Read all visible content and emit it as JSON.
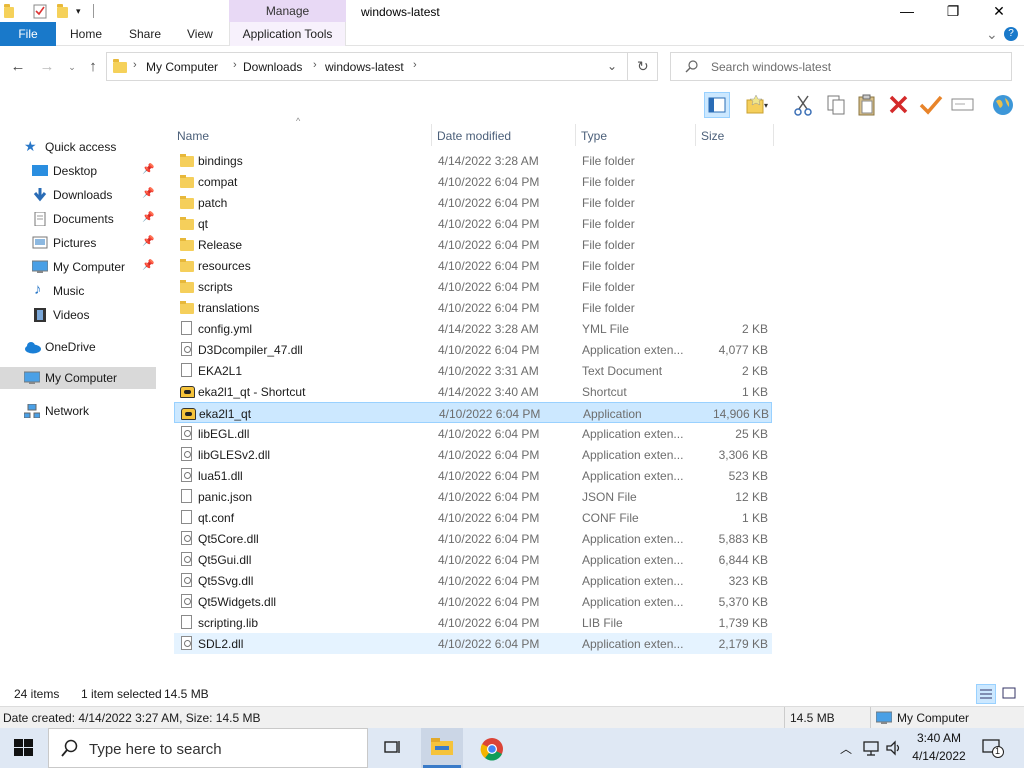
{
  "window": {
    "title": "windows-latest",
    "manage_label": "Manage",
    "minimize": "—",
    "maximize": "❐",
    "close": "✕"
  },
  "ribbon": {
    "file": "File",
    "home": "Home",
    "share": "Share",
    "view": "View",
    "app_tools": "Application Tools",
    "expand": "⌄",
    "help": "?"
  },
  "address": {
    "crumbs": [
      "My Computer",
      "Downloads",
      "windows-latest"
    ],
    "search_placeholder": "Search windows-latest"
  },
  "navpane": {
    "quick_access": "Quick access",
    "quick_items": [
      {
        "label": "Desktop",
        "icon": "desktop-icon"
      },
      {
        "label": "Downloads",
        "icon": "download-arrow-icon"
      },
      {
        "label": "Documents",
        "icon": "document-icon"
      },
      {
        "label": "Pictures",
        "icon": "picture-icon"
      },
      {
        "label": "My Computer",
        "icon": "computer-icon"
      },
      {
        "label": "Music",
        "icon": "music-note-icon"
      },
      {
        "label": "Videos",
        "icon": "film-icon"
      }
    ],
    "onedrive": "OneDrive",
    "my_computer": "My Computer",
    "network": "Network"
  },
  "columns": {
    "name": "Name",
    "date": "Date modified",
    "type": "Type",
    "size": "Size"
  },
  "files": [
    {
      "name": "bindings",
      "date": "4/14/2022 3:28 AM",
      "type": "File folder",
      "size": "",
      "kind": "folder"
    },
    {
      "name": "compat",
      "date": "4/10/2022 6:04 PM",
      "type": "File folder",
      "size": "",
      "kind": "folder"
    },
    {
      "name": "patch",
      "date": "4/10/2022 6:04 PM",
      "type": "File folder",
      "size": "",
      "kind": "folder"
    },
    {
      "name": "qt",
      "date": "4/10/2022 6:04 PM",
      "type": "File folder",
      "size": "",
      "kind": "folder"
    },
    {
      "name": "Release",
      "date": "4/10/2022 6:04 PM",
      "type": "File folder",
      "size": "",
      "kind": "folder"
    },
    {
      "name": "resources",
      "date": "4/10/2022 6:04 PM",
      "type": "File folder",
      "size": "",
      "kind": "folder"
    },
    {
      "name": "scripts",
      "date": "4/10/2022 6:04 PM",
      "type": "File folder",
      "size": "",
      "kind": "folder"
    },
    {
      "name": "translations",
      "date": "4/10/2022 6:04 PM",
      "type": "File folder",
      "size": "",
      "kind": "folder"
    },
    {
      "name": "config.yml",
      "date": "4/14/2022 3:28 AM",
      "type": "YML File",
      "size": "2 KB",
      "kind": "file"
    },
    {
      "name": "D3Dcompiler_47.dll",
      "date": "4/10/2022 6:04 PM",
      "type": "Application exten...",
      "size": "4,077 KB",
      "kind": "dll"
    },
    {
      "name": "EKA2L1",
      "date": "4/10/2022 3:31 AM",
      "type": "Text Document",
      "size": "2 KB",
      "kind": "file"
    },
    {
      "name": "eka2l1_qt - Shortcut",
      "date": "4/14/2022 3:40 AM",
      "type": "Shortcut",
      "size": "1 KB",
      "kind": "app"
    },
    {
      "name": "eka2l1_qt",
      "date": "4/10/2022 6:04 PM",
      "type": "Application",
      "size": "14,906 KB",
      "kind": "app",
      "selected": true
    },
    {
      "name": "libEGL.dll",
      "date": "4/10/2022 6:04 PM",
      "type": "Application exten...",
      "size": "25 KB",
      "kind": "dll"
    },
    {
      "name": "libGLESv2.dll",
      "date": "4/10/2022 6:04 PM",
      "type": "Application exten...",
      "size": "3,306 KB",
      "kind": "dll"
    },
    {
      "name": "lua51.dll",
      "date": "4/10/2022 6:04 PM",
      "type": "Application exten...",
      "size": "523 KB",
      "kind": "dll"
    },
    {
      "name": "panic.json",
      "date": "4/10/2022 6:04 PM",
      "type": "JSON File",
      "size": "12 KB",
      "kind": "file"
    },
    {
      "name": "qt.conf",
      "date": "4/10/2022 6:04 PM",
      "type": "CONF File",
      "size": "1 KB",
      "kind": "file"
    },
    {
      "name": "Qt5Core.dll",
      "date": "4/10/2022 6:04 PM",
      "type": "Application exten...",
      "size": "5,883 KB",
      "kind": "dll"
    },
    {
      "name": "Qt5Gui.dll",
      "date": "4/10/2022 6:04 PM",
      "type": "Application exten...",
      "size": "6,844 KB",
      "kind": "dll"
    },
    {
      "name": "Qt5Svg.dll",
      "date": "4/10/2022 6:04 PM",
      "type": "Application exten...",
      "size": "323 KB",
      "kind": "dll"
    },
    {
      "name": "Qt5Widgets.dll",
      "date": "4/10/2022 6:04 PM",
      "type": "Application exten...",
      "size": "5,370 KB",
      "kind": "dll"
    },
    {
      "name": "scripting.lib",
      "date": "4/10/2022 6:04 PM",
      "type": "LIB File",
      "size": "1,739 KB",
      "kind": "file"
    },
    {
      "name": "SDL2.dll",
      "date": "4/10/2022 6:04 PM",
      "type": "Application exten...",
      "size": "2,179 KB",
      "kind": "dll",
      "hover": true
    }
  ],
  "status": {
    "items": "24 items",
    "selected": "1 item selected",
    "sel_size": "14.5 MB"
  },
  "details": {
    "text": "Date created: 4/14/2022 3:27 AM, Size: 14.5 MB",
    "size": "14.5 MB",
    "location": "My Computer"
  },
  "taskbar": {
    "search_placeholder": "Type here to search",
    "time": "3:40 AM",
    "date": "4/14/2022",
    "notification_count": "1"
  },
  "colors": {
    "accent": "#1979ca",
    "selection": "#cce8ff",
    "manage_tab": "#e8d9f5"
  }
}
